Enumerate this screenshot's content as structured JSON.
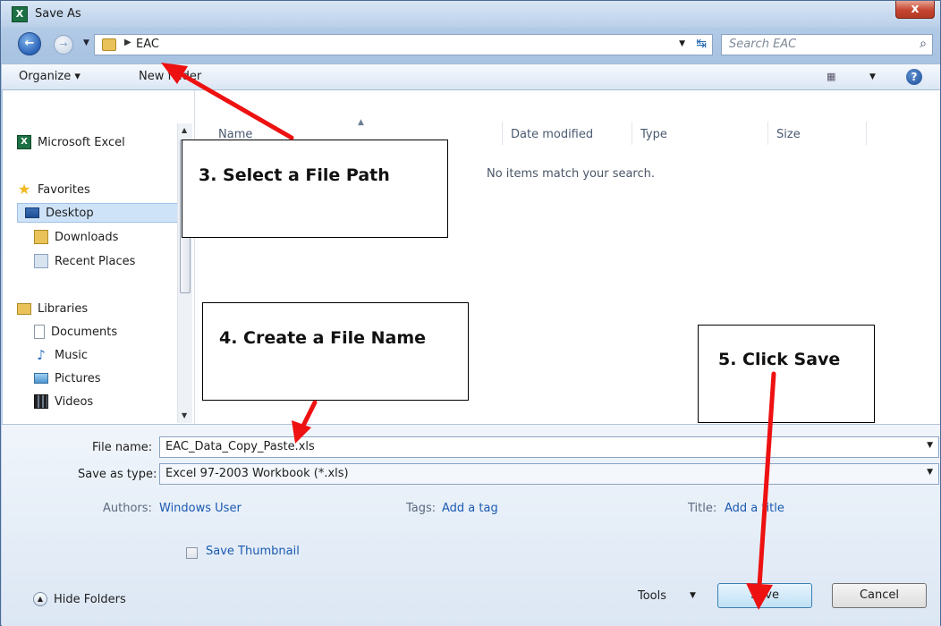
{
  "window": {
    "title": "Save As",
    "close": "x"
  },
  "address": {
    "crumb": "EAC",
    "search_placeholder": "Search EAC"
  },
  "toolbar": {
    "organize": "Organize ▾",
    "new_folder": "New folder"
  },
  "nav": {
    "microsoft_excel": "Microsoft Excel",
    "favorites": "Favorites",
    "desktop": "Desktop",
    "downloads": "Downloads",
    "recent_places": "Recent Places",
    "libraries": "Libraries",
    "documents": "Documents",
    "music": "Music",
    "pictures": "Pictures",
    "videos": "Videos"
  },
  "columns": {
    "name": "Name",
    "date_modified": "Date modified",
    "type": "Type",
    "size": "Size"
  },
  "empty_message": "No items match your search.",
  "form": {
    "file_name_label": "File name:",
    "file_name_value": "EAC_Data_Copy_Paste.xls",
    "save_type_label": "Save as type:",
    "save_type_value": "Excel 97-2003 Workbook (*.xls)",
    "authors_label": "Authors:",
    "authors_value": "Windows User",
    "tags_label": "Tags:",
    "tags_value": "Add a tag",
    "title_label": "Title:",
    "title_value": "Add a title",
    "save_thumbnail": "Save Thumbnail",
    "hide_folders": "Hide Folders",
    "tools": "Tools",
    "save": "Save",
    "cancel": "Cancel"
  },
  "annotations": {
    "step3": "3. Select a File Path",
    "step4": "4. Create a File Name",
    "step5": "5. Click Save",
    "arrow_color": "#ee1111"
  }
}
